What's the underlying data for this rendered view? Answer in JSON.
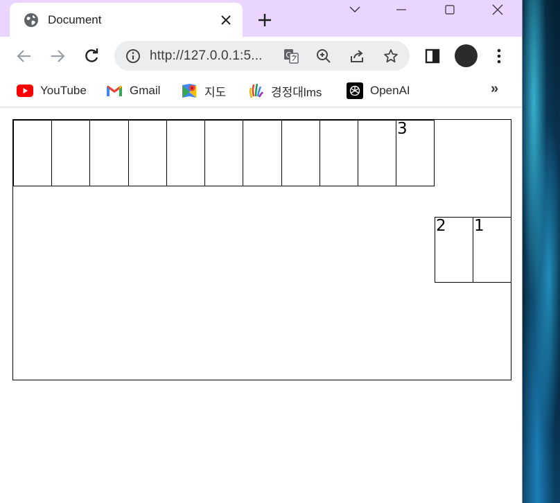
{
  "tab": {
    "title": "Document"
  },
  "toolbar": {
    "url": "http://127.0.0.1:5..."
  },
  "bookmarks": [
    {
      "label": "YouTube",
      "icon": "youtube-icon"
    },
    {
      "label": "Gmail",
      "icon": "gmail-icon"
    },
    {
      "label": "지도",
      "icon": "maps-icon"
    },
    {
      "label": "경정대lms",
      "icon": "lms-icon"
    },
    {
      "label": "OpenAI",
      "icon": "openai-icon"
    }
  ],
  "bookmarks_overflow": "»",
  "page": {
    "top_row_cells": [
      "",
      "",
      "",
      "",
      "",
      "",
      "",
      "",
      "",
      "",
      "3"
    ],
    "side_cells": [
      "2",
      "1"
    ]
  }
}
